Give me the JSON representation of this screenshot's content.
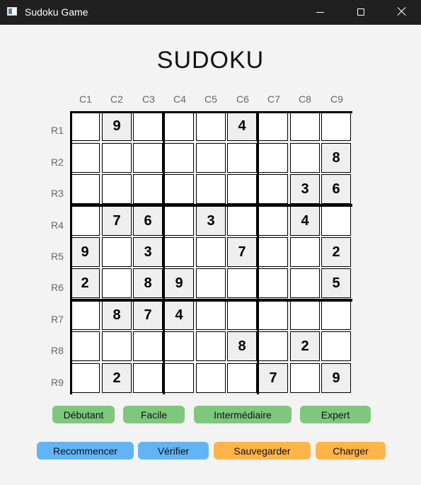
{
  "window": {
    "title": "Sudoku Game"
  },
  "heading": "SUDOKU",
  "columns": [
    "C1",
    "C2",
    "C3",
    "C4",
    "C5",
    "C6",
    "C7",
    "C8",
    "C9"
  ],
  "rows": [
    "R1",
    "R2",
    "R3",
    "R4",
    "R5",
    "R6",
    "R7",
    "R8",
    "R9"
  ],
  "board": [
    [
      "",
      "9",
      "",
      "",
      "",
      "4",
      "",
      "",
      ""
    ],
    [
      "",
      "",
      "",
      "",
      "",
      "",
      "",
      "",
      "8"
    ],
    [
      "",
      "",
      "",
      "",
      "",
      "",
      "",
      "3",
      "6"
    ],
    [
      "",
      "7",
      "6",
      "",
      "3",
      "",
      "",
      "4",
      ""
    ],
    [
      "9",
      "",
      "3",
      "",
      "",
      "7",
      "",
      "",
      "2"
    ],
    [
      "2",
      "",
      "8",
      "9",
      "",
      "",
      "",
      "",
      "5"
    ],
    [
      "",
      "8",
      "7",
      "4",
      "",
      "",
      "",
      "",
      ""
    ],
    [
      "",
      "",
      "",
      "",
      "",
      "8",
      "",
      "2",
      ""
    ],
    [
      "",
      "2",
      "",
      "",
      "",
      "",
      "7",
      "",
      "9"
    ]
  ],
  "difficulty_buttons": [
    "Débutant",
    "Facile",
    "Intermédiaire",
    "Expert"
  ],
  "action_buttons": [
    "Recommencer",
    "Vérifier",
    "Sauvegarder",
    "Charger"
  ],
  "colors": {
    "difficulty": "#7fc77f",
    "restart_verify": "#63b4f5",
    "save_load": "#ffb44a",
    "given_cell": "#efefef"
  }
}
